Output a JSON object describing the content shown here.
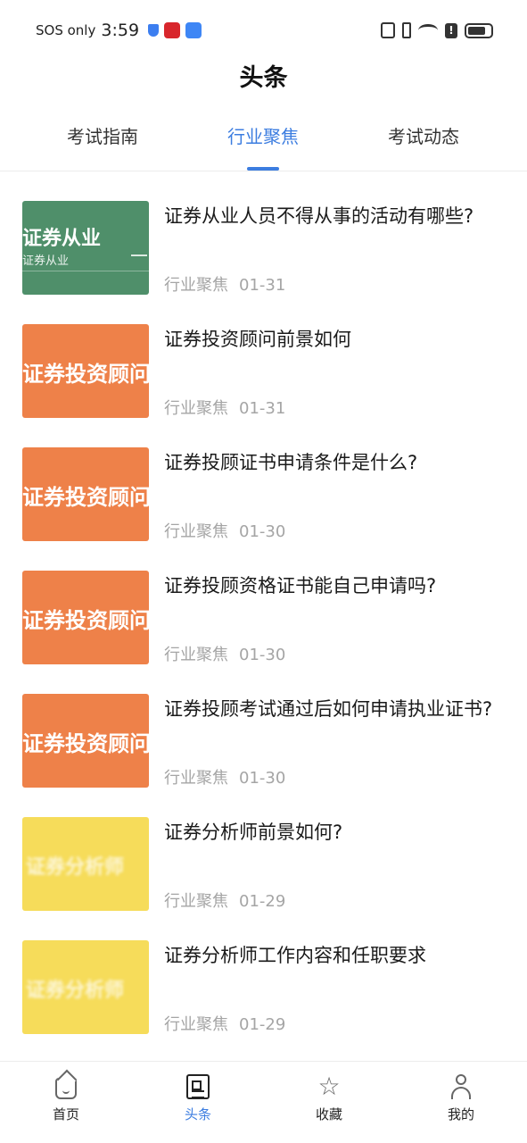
{
  "status_bar": {
    "carrier": "SOS only",
    "time": "3:59"
  },
  "header": {
    "title": "头条"
  },
  "tabs": [
    {
      "label": "考试指南",
      "active": false
    },
    {
      "label": "行业聚焦",
      "active": true
    },
    {
      "label": "考试动态",
      "active": false
    }
  ],
  "articles": [
    {
      "thumb_text": "证券从业",
      "thumb_subtext": "证券从业",
      "thumb_color": "#4f8f6a",
      "title": "证券从业人员不得从事的活动有哪些?",
      "category": "行业聚焦",
      "date": "01-31"
    },
    {
      "thumb_text": "证券投资顾问",
      "thumb_color": "#ee8149",
      "title": "证券投资顾问前景如何",
      "category": "行业聚焦",
      "date": "01-31"
    },
    {
      "thumb_text": "证券投资顾问",
      "thumb_color": "#ee8149",
      "title": "证券投顾证书申请条件是什么?",
      "category": "行业聚焦",
      "date": "01-30"
    },
    {
      "thumb_text": "证券投资顾问",
      "thumb_color": "#ee8149",
      "title": "证券投顾资格证书能自己申请吗?",
      "category": "行业聚焦",
      "date": "01-30"
    },
    {
      "thumb_text": "证券投资顾问",
      "thumb_color": "#ee8149",
      "title": "证券投顾考试通过后如何申请执业证书?",
      "category": "行业聚焦",
      "date": "01-30"
    },
    {
      "thumb_text": "证券分析师",
      "thumb_color": "#f6dc5a",
      "title": "证券分析师前景如何?",
      "category": "行业聚焦",
      "date": "01-29"
    },
    {
      "thumb_text": "证券分析师",
      "thumb_color": "#f6dc5a",
      "title": "证券分析师工作内容和任职要求",
      "category": "行业聚焦",
      "date": "01-29"
    }
  ],
  "bottom_nav": [
    {
      "label": "首页",
      "icon": "home-icon",
      "active": false
    },
    {
      "label": "头条",
      "icon": "news-icon",
      "active": true
    },
    {
      "label": "收藏",
      "icon": "star-icon",
      "active": false
    },
    {
      "label": "我的",
      "icon": "user-icon",
      "active": false
    }
  ],
  "colors": {
    "accent": "#3c7de0",
    "meta_text": "#a5a5a5"
  }
}
